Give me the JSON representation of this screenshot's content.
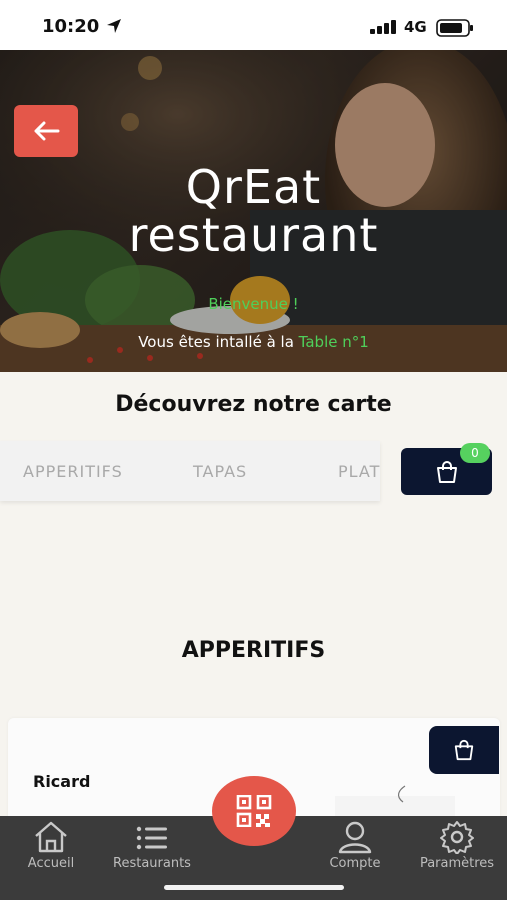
{
  "status_bar": {
    "time": "10:20",
    "network": "4G"
  },
  "hero": {
    "title_line1": "QrEat",
    "title_line2": "restaurant",
    "welcome": "Bienvenue !",
    "table_prefix": "Vous êtes intallé à la",
    "table_value": "Table n°1"
  },
  "menu": {
    "heading": "Découvrez notre carte",
    "tabs": [
      "APPERITIFS",
      "TAPAS",
      "PLATS"
    ],
    "cart_count": "0",
    "category_title": "APPERITIFS",
    "products": [
      {
        "name": "Ricard"
      }
    ]
  },
  "tab_bar": {
    "items": [
      {
        "label": "Accueil",
        "icon": "home-icon"
      },
      {
        "label": "Restaurants",
        "icon": "list-icon"
      },
      {
        "label": "Compte",
        "icon": "user-icon"
      },
      {
        "label": "Paramètres",
        "icon": "gear-icon"
      }
    ],
    "center_icon": "qr-code-icon"
  },
  "colors": {
    "accent": "#e4574a",
    "navy": "#0c1630",
    "green": "#4fcf5a",
    "tab_bar": "#3b3b3b"
  }
}
